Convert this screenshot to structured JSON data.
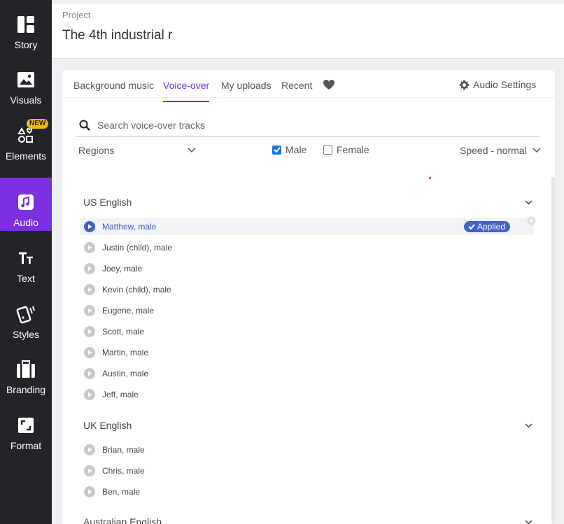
{
  "sidebar": {
    "items": [
      {
        "label": "Story",
        "icon": "story-icon"
      },
      {
        "label": "Visuals",
        "icon": "image-icon"
      },
      {
        "label": "Elements",
        "icon": "shapes-icon",
        "badge": "NEW"
      },
      {
        "label": "Audio",
        "icon": "music-note-icon",
        "active": true
      },
      {
        "label": "Text",
        "icon": "text-icon"
      },
      {
        "label": "Styles",
        "icon": "styles-icon"
      },
      {
        "label": "Branding",
        "icon": "briefcase-icon"
      },
      {
        "label": "Format",
        "icon": "format-icon"
      }
    ],
    "active_color": "#7b2fe0",
    "badge_color": "#f5b810"
  },
  "header": {
    "label": "Project",
    "title": "The 4th industrial r"
  },
  "panel": {
    "tabs": [
      {
        "label": "Background music"
      },
      {
        "label": "Voice-over",
        "active": true
      },
      {
        "label": "My uploads"
      },
      {
        "label": "Recent"
      }
    ],
    "audio_settings": "Audio Settings",
    "search_placeholder": "Search voice-over tracks",
    "filters": {
      "regions": "Regions",
      "male": "Male",
      "male_checked": true,
      "female": "Female",
      "female_checked": false,
      "speed": "Speed - normal"
    },
    "sections": [
      {
        "title": "US English",
        "voices": [
          {
            "name": "Matthew, male",
            "applied": true
          },
          {
            "name": "Justin (child), male"
          },
          {
            "name": "Joey, male"
          },
          {
            "name": "Kevin (child), male"
          },
          {
            "name": "Eugene, male"
          },
          {
            "name": "Scott, male"
          },
          {
            "name": "Martin, male"
          },
          {
            "name": "Austin, male"
          },
          {
            "name": "Jeff, male"
          }
        ]
      },
      {
        "title": "UK English",
        "voices": [
          {
            "name": "Brian, male"
          },
          {
            "name": "Chris, male"
          },
          {
            "name": "Ben, male"
          }
        ]
      },
      {
        "title": "Australian English",
        "voices": []
      }
    ],
    "applied_label": "Applied",
    "accent": "#7b2fe0",
    "applied_color": "#3e62c7"
  }
}
